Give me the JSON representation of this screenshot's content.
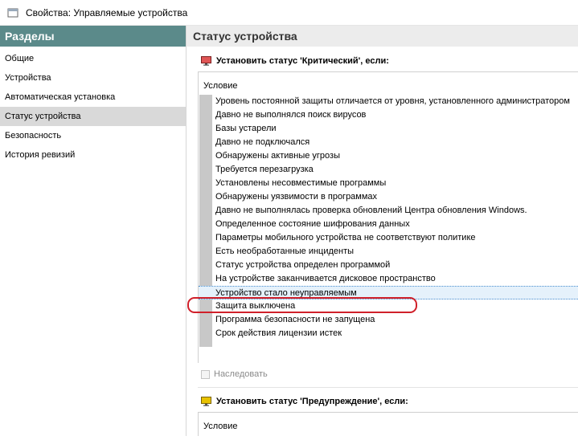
{
  "window": {
    "title": "Свойства: Управляемые устройства"
  },
  "sidebar": {
    "header": "Разделы",
    "items": [
      {
        "label": "Общие"
      },
      {
        "label": "Устройства"
      },
      {
        "label": "Автоматическая установка"
      },
      {
        "label": "Статус устройства"
      },
      {
        "label": "Безопасность"
      },
      {
        "label": "История ревизий"
      }
    ],
    "active_index": 3
  },
  "main": {
    "header": "Статус устройства",
    "critical": {
      "title": "Установить статус 'Критический', если:",
      "column_header": "Условие",
      "conditions": [
        "Уровень постоянной защиты отличается от уровня, установленного администратором",
        "Давно не выполнялся поиск вирусов",
        "Базы устарели",
        "Давно не подключался",
        "Обнаружены активные угрозы",
        "Требуется перезагрузка",
        "Установлены несовместимые программы",
        "Обнаружены уязвимости в программах",
        "Давно не выполнялась проверка обновлений Центра обновления Windows.",
        "Определенное состояние шифрования данных",
        "Параметры мобильного устройства не соответствуют политике",
        "Есть необработанные инциденты",
        "Статус устройства определен программой",
        "На устройстве заканчивается дисковое пространство",
        "Устройство стало неуправляемым",
        "Защита выключена",
        "Программа безопасности не запущена",
        "Срок действия лицензии истек"
      ],
      "selected_index": 14,
      "icon_color": "#e05555"
    },
    "inherit_label": "Наследовать",
    "warning": {
      "title": "Установить статус 'Предупреждение', если:",
      "column_header": "Условие",
      "icon_color": "#e8c200"
    }
  },
  "colors": {
    "sidebar_header_bg": "#5b8a8a",
    "main_header_bg": "#ececec",
    "selection_bg": "#e5f1fb",
    "annotation_ring": "#d0202a"
  }
}
